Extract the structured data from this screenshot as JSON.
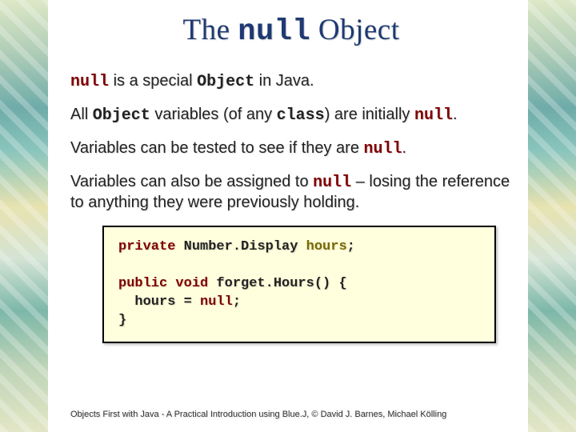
{
  "title": {
    "pre": "The ",
    "kw": "null",
    "post": " Object"
  },
  "paras": {
    "p1": {
      "s1": "null",
      "s2": " is a special ",
      "s3": "Object",
      "s4": " in Java."
    },
    "p2": {
      "s1": "All ",
      "s2": "Object",
      "s3": " variables (of any ",
      "s4": "class",
      "s5": ") are initially ",
      "s6": "null",
      "s7": "."
    },
    "p3": {
      "s1": "Variables can be tested to see if they are ",
      "s2": "null",
      "s3": "."
    },
    "p4": {
      "s1": "Variables can also be assigned to ",
      "s2": "null",
      "s3": " – losing the reference to anything they were previously holding."
    }
  },
  "code": {
    "l1a": "private",
    "l1b": " Number.Display ",
    "l1c": "hours",
    "l1d": ";",
    "blank": " ",
    "l2a": "public void",
    "l2b": " forget.Hours() {",
    "l3a": "  hours = ",
    "l3b": "null",
    "l3c": ";",
    "l4": "}"
  },
  "footer": "Objects First with Java - A Practical Introduction using Blue.J, © David J. Barnes, Michael Kölling"
}
